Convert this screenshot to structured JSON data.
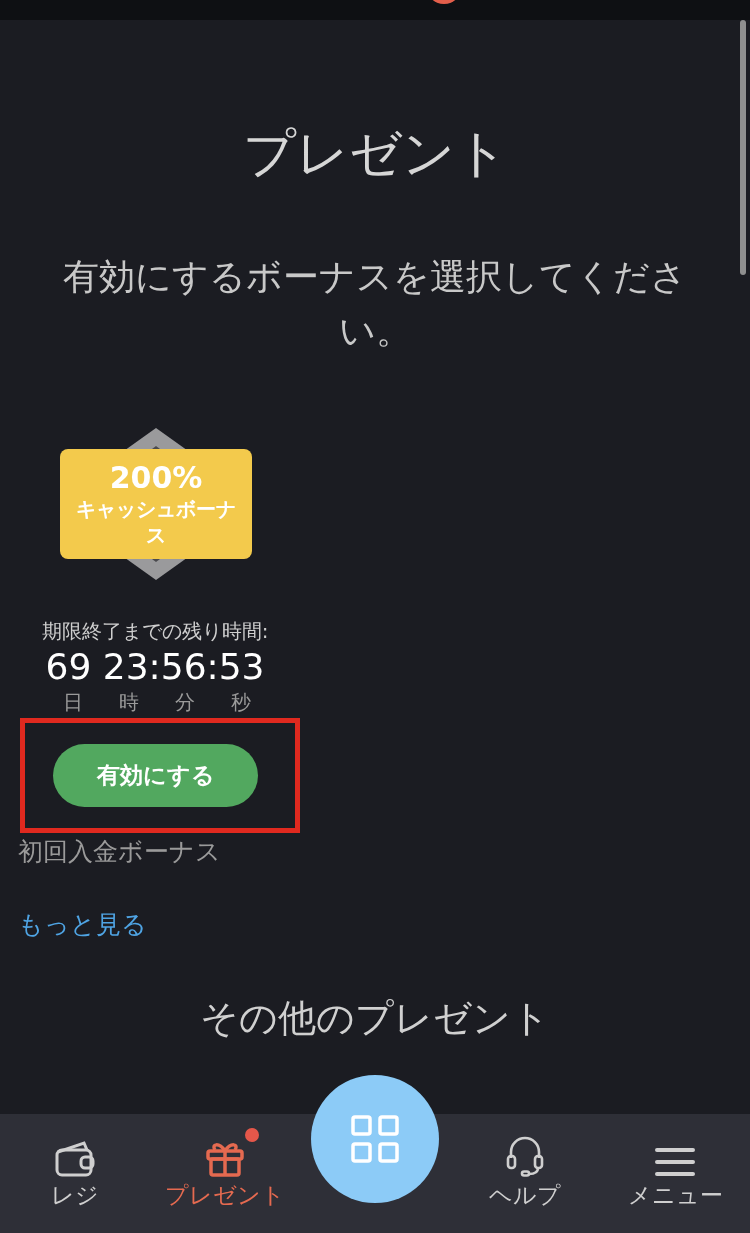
{
  "title": "プレゼント",
  "subtitle": "有効にするボーナスを選択してください。",
  "bonus": {
    "percent": "200%",
    "name": "キャッシュボーナス",
    "timer_label": "期限終了までの残り時間:",
    "time": "69 23:56:53",
    "units": [
      "日",
      "時",
      "分",
      "秒"
    ],
    "button": "有効にする",
    "highlighted": true,
    "description": "初回入金ボーナス"
  },
  "more_link": "もっと見る",
  "other_heading": "その他のプレゼント",
  "nav": [
    {
      "label": "レジ",
      "kind": "wallet",
      "selected": false,
      "badge": false
    },
    {
      "label": "プレゼント",
      "kind": "gift",
      "selected": true,
      "badge": true
    },
    {
      "kind": "center"
    },
    {
      "label": "ヘルプ",
      "kind": "headset",
      "selected": false,
      "badge": false
    },
    {
      "label": "メニュー",
      "kind": "menu",
      "selected": false,
      "badge": false
    }
  ]
}
